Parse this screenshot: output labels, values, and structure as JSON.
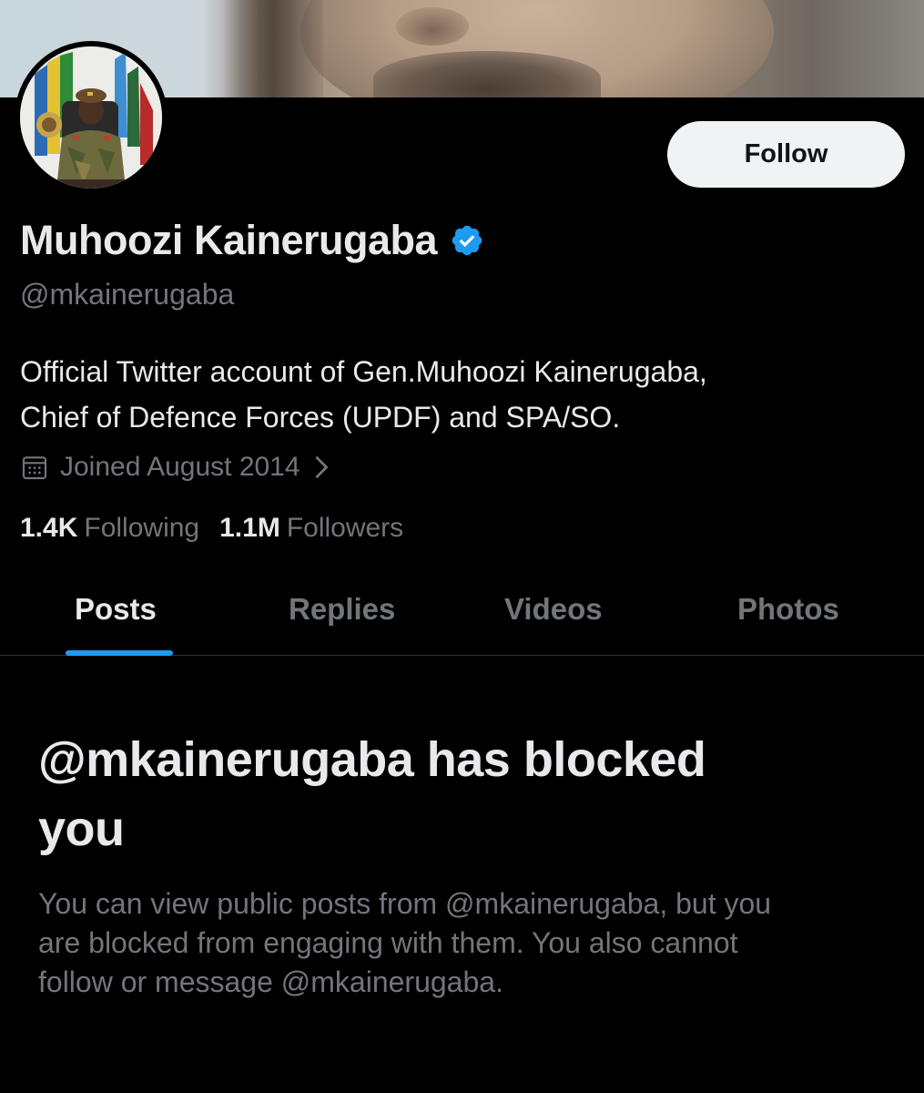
{
  "profile": {
    "display_name": "Muhoozi Kainerugaba",
    "handle": "@mkainerugaba",
    "bio_lines": [
      "Official Twitter account of Gen.Muhoozi Kainerugaba,",
      "Chief of Defence Forces (UPDF) and SPA/SO."
    ],
    "joined": "Joined August 2014",
    "following_count": "1.4K",
    "following_label": "Following",
    "followers_count": "1.1M",
    "followers_label": "Followers"
  },
  "follow_button": {
    "label": "Follow"
  },
  "tabs": [
    {
      "label": "Posts",
      "active": true
    },
    {
      "label": "Replies",
      "active": false
    },
    {
      "label": "Videos",
      "active": false
    },
    {
      "label": "Photos",
      "active": false
    }
  ],
  "blocked": {
    "title_lines": [
      "@mkainerugaba has blocked",
      "you"
    ],
    "description_lines": [
      "You can view public posts from @mkainerugaba, but you",
      "are blocked from engaging with them. You also cannot",
      "follow or message @mkainerugaba."
    ]
  },
  "icons": {
    "verified": "verified-badge-icon",
    "calendar": "calendar-icon",
    "chevron": "chevron-right-icon"
  },
  "colors": {
    "background": "#000000",
    "text_primary": "#e7e9ea",
    "text_secondary": "#71767b",
    "accent": "#1d9bf0",
    "follow_button_bg": "#eff3f4"
  }
}
